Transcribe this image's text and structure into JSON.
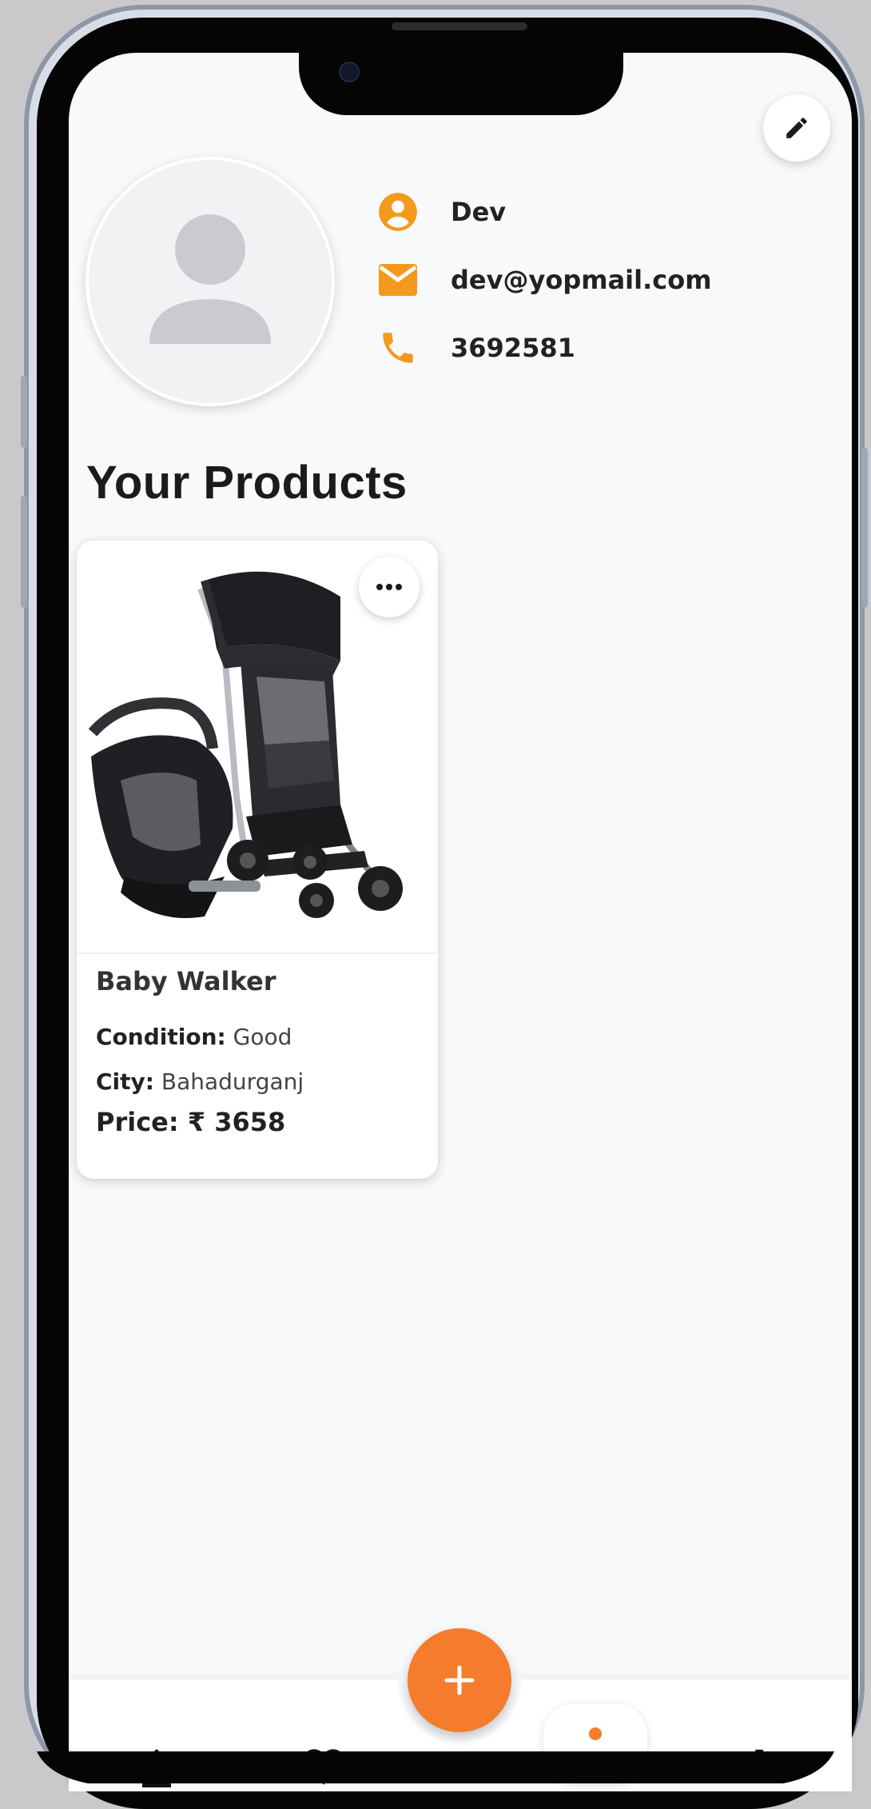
{
  "profile": {
    "name": "Dev",
    "email": "dev@yopmail.com",
    "phone": "3692581"
  },
  "section_title": "Your Products",
  "products": [
    {
      "title": "Baby Walker",
      "condition_label": "Condition:",
      "condition_value": "Good",
      "city_label": "City:",
      "city_value": "Bahadurganj",
      "price_label": "Price:",
      "price_value": "₹ 3658",
      "image_icon": "stroller-product-image"
    }
  ],
  "nav": {
    "items": [
      "home-icon",
      "heart-icon",
      "profile-dot-icon",
      "settings-icon"
    ],
    "active": "profile-dot-icon",
    "fab_icon": "plus-icon"
  },
  "colors": {
    "accent": "#f47c2c",
    "icon_orange": "#f39a1e",
    "background": "#f7f9fb",
    "text_dark": "#1b1b1b"
  }
}
